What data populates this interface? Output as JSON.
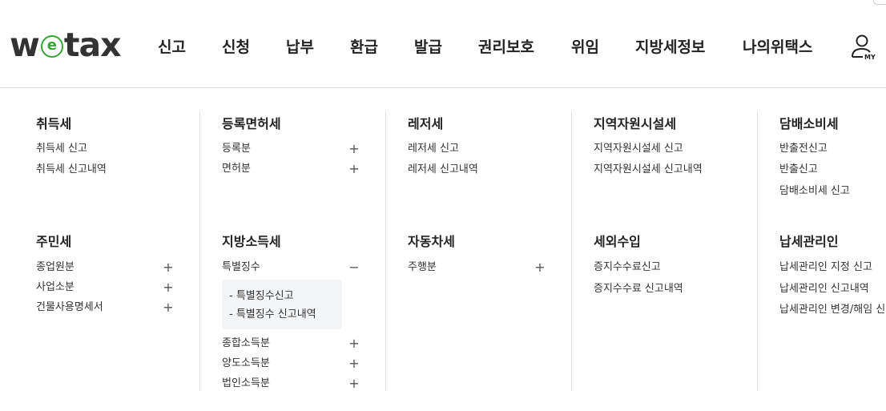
{
  "logo": {
    "w": "w",
    "e": "e",
    "tax": "tax"
  },
  "nav": [
    "신고",
    "신청",
    "납부",
    "환급",
    "발급",
    "권리보호",
    "위임",
    "지방세정보",
    "나의위택스"
  ],
  "my_label": "MY",
  "colors": {
    "brand_green": "#3aa335",
    "divider": "#e2e2e2",
    "submenu_bg": "#f4f5f7"
  },
  "menu": {
    "col1": {
      "cat1": {
        "title": "취득세",
        "items": [
          "취득세 신고",
          "취득세 신고내역"
        ]
      },
      "cat2": {
        "title": "주민세",
        "items": [
          "종업원분",
          "사업소분",
          "건물사용명세서"
        ]
      }
    },
    "col2": {
      "cat1": {
        "title": "등록면허세",
        "items": [
          "등록분",
          "면허분"
        ]
      },
      "cat2": {
        "title": "지방소득세",
        "items": [
          "특별징수",
          "종합소득분",
          "양도소득분",
          "법인소득분"
        ],
        "sub": [
          "- 특별징수신고",
          "- 특별징수 신고내역"
        ]
      }
    },
    "col3": {
      "cat1": {
        "title": "레저세",
        "items": [
          "레저세 신고",
          "레저세 신고내역"
        ]
      },
      "cat2": {
        "title": "자동차세",
        "items": [
          "주행분"
        ]
      }
    },
    "col4": {
      "cat1": {
        "title": "지역자원시설세",
        "items": [
          "지역자원시설세 신고",
          "지역자원시설세 신고내역"
        ]
      },
      "cat2": {
        "title": "세외수입",
        "items": [
          "증지수수료신고",
          "증지수수료 신고내역"
        ]
      }
    },
    "col5": {
      "cat1": {
        "title": "담배소비세",
        "items": [
          "반출전신고",
          "반출신고",
          "담배소비세 신고"
        ]
      },
      "cat2": {
        "title": "납세관리인",
        "items": [
          "납세관리인 지정 신고",
          "납세관리인 신고내역",
          "납세관리인 변경/해임 신고"
        ]
      }
    }
  },
  "toggles": {
    "plus": "+",
    "minus": "−"
  }
}
